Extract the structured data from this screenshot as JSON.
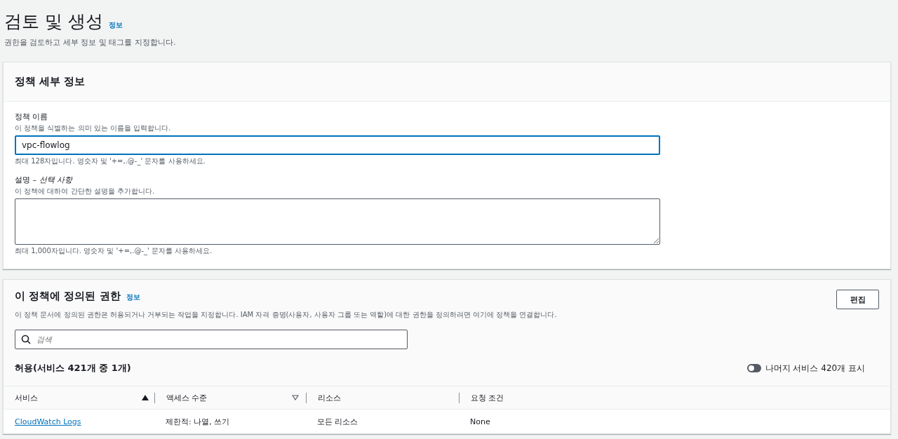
{
  "header": {
    "title": "검토 및 생성",
    "info_link": "정보",
    "description": "권한을 검토하고 세부 정보 및 태그를 지정합니다."
  },
  "policy_details": {
    "title": "정책 세부 정보",
    "name_field": {
      "label": "정책 이름",
      "hint": "이 정책을 식별하는 의미 있는 이름을 입력합니다.",
      "value": "vpc-flowlog",
      "constraint": "최대 128자입니다. 영숫자 및 '+=,.@-_' 문자를 사용하세요."
    },
    "description_field": {
      "label": "설명 – ",
      "label_optional": "선택 사항",
      "hint": "이 정책에 대하여 간단한 설명을 추가합니다.",
      "constraint": "최대 1,000자입니다. 영숫자 및 '+=,.@-_' 문자를 사용하세요."
    }
  },
  "permissions": {
    "title": "이 정책에 정의된 권한",
    "info_link": "정보",
    "edit_button": "편집",
    "description": "이 정책 문서에 정의된 권한은 허용되거나 거부되는 작업을 지정합니다. IAM 자격 증명(사용자, 사용자 그룹 또는 역할)에 대한 권한을 정의하려면 여기에 정책을 연결합니다.",
    "search": {
      "placeholder": "검색"
    },
    "allow_heading": "허용(서비스 421개 중 1개)",
    "toggle": {
      "label": "나머지 서비스 420개 표시",
      "on": false
    },
    "table": {
      "columns": [
        {
          "label": "서비스",
          "sorted": true
        },
        {
          "label": "액세스 수준",
          "sorted": false
        },
        {
          "label": "리소스"
        },
        {
          "label": "요청 조건"
        }
      ],
      "rows": [
        {
          "service": "CloudWatch Logs",
          "access_level": "제한적: 나열, 쓰기",
          "resource": "모든 리소스",
          "condition": "None"
        }
      ]
    }
  }
}
